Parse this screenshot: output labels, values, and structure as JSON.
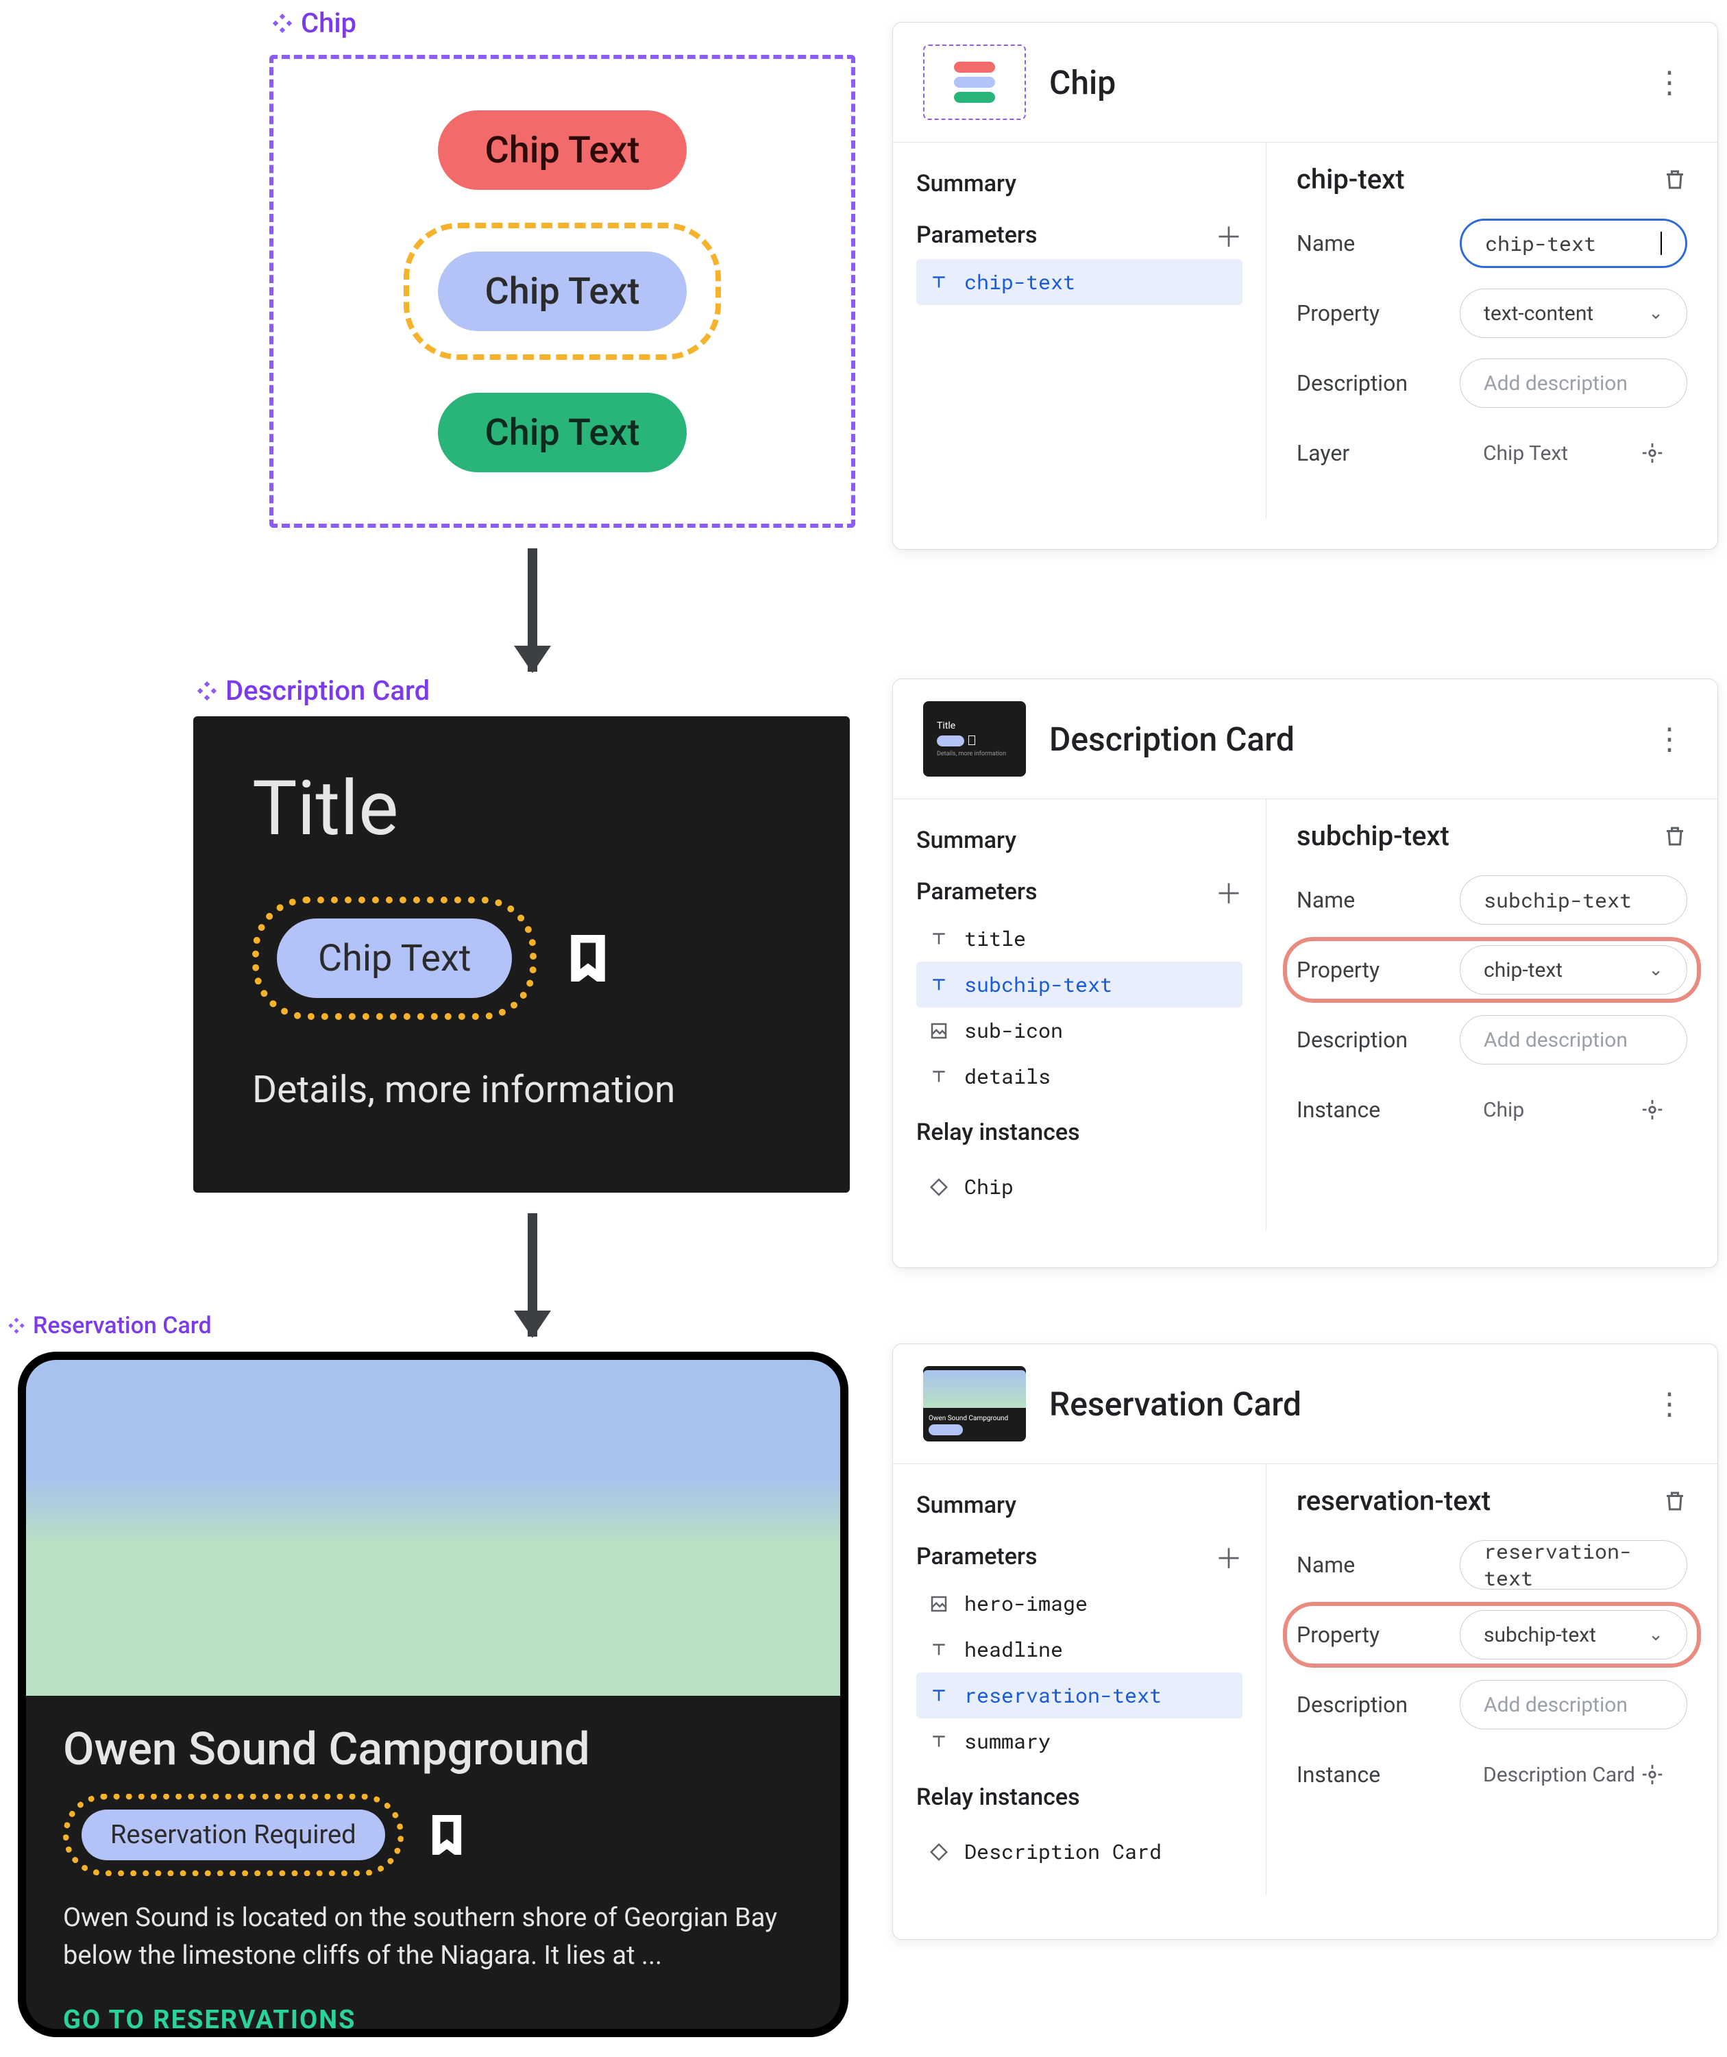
{
  "labels": {
    "chip": "Chip",
    "descCard": "Description Card",
    "resCard": "Reservation Card"
  },
  "chipCanvas": {
    "red": "Chip Text",
    "blue": "Chip Text",
    "green": "Chip Text"
  },
  "descCard": {
    "title": "Title",
    "chip": "Chip Text",
    "details": "Details, more information"
  },
  "resCard": {
    "headline": "Owen Sound Campground",
    "chip": "Reservation Required",
    "summary": "Owen Sound is located on the southern shore of Georgian Bay below the limestone cliffs of the Niagara. It lies at ...",
    "cta": "GO TO RESERVATIONS"
  },
  "panels": {
    "common": {
      "summary": "Summary",
      "parameters": "Parameters",
      "relayInstances": "Relay instances",
      "nameLabel": "Name",
      "propertyLabel": "Property",
      "descLabel": "Description",
      "descPh": "Add description",
      "layerLabel": "Layer",
      "instanceLabel": "Instance"
    },
    "chip": {
      "title": "Chip",
      "params": [
        "chip-text"
      ],
      "selected": "chip-text",
      "detailTitle": "chip-text",
      "nameVal": "chip-text",
      "propVal": "text-content",
      "layerVal": "Chip Text"
    },
    "desc": {
      "title": "Description Card",
      "params": [
        "title",
        "subchip-text",
        "sub-icon",
        "details"
      ],
      "selected": "subchip-text",
      "instances": [
        "Chip"
      ],
      "detailTitle": "subchip-text",
      "nameVal": "subchip-text",
      "propVal": "chip-text",
      "instanceVal": "Chip"
    },
    "res": {
      "title": "Reservation Card",
      "params": [
        "hero-image",
        "headline",
        "reservation-text",
        "summary"
      ],
      "selected": "reservation-text",
      "instances": [
        "Description Card"
      ],
      "detailTitle": "reservation-text",
      "nameVal": "reservation-text",
      "propVal": "subchip-text",
      "instanceVal": "Description Card"
    }
  }
}
